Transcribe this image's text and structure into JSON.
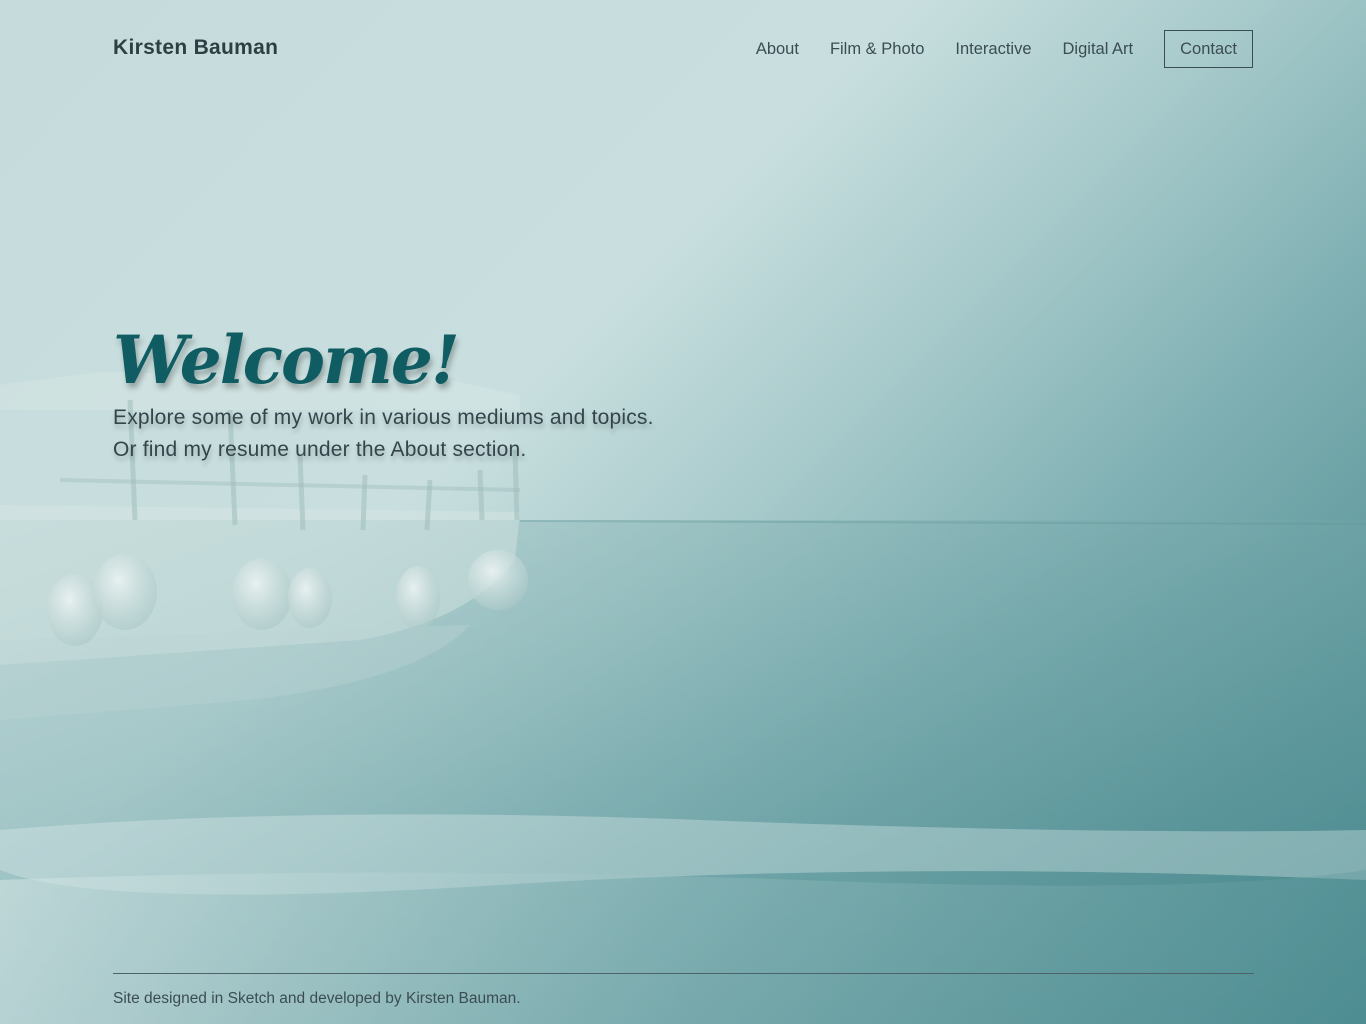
{
  "header": {
    "brand": "Kirsten Bauman",
    "nav": [
      {
        "label": "About"
      },
      {
        "label": "Film & Photo"
      },
      {
        "label": "Interactive"
      },
      {
        "label": "Digital Art"
      },
      {
        "label": "Contact"
      }
    ]
  },
  "hero": {
    "title": "Welcome!",
    "body": "Explore some of my work in various mediums and topics. Or find my resume under the About section."
  },
  "footer": {
    "credit": "Site designed in Sketch and developed by Kirsten Bauman."
  },
  "colors": {
    "accent_title": "#0f5c63",
    "text": "#34464b",
    "sea_dark": "#4b8a8f",
    "sky_light": "#c9dfdf"
  }
}
